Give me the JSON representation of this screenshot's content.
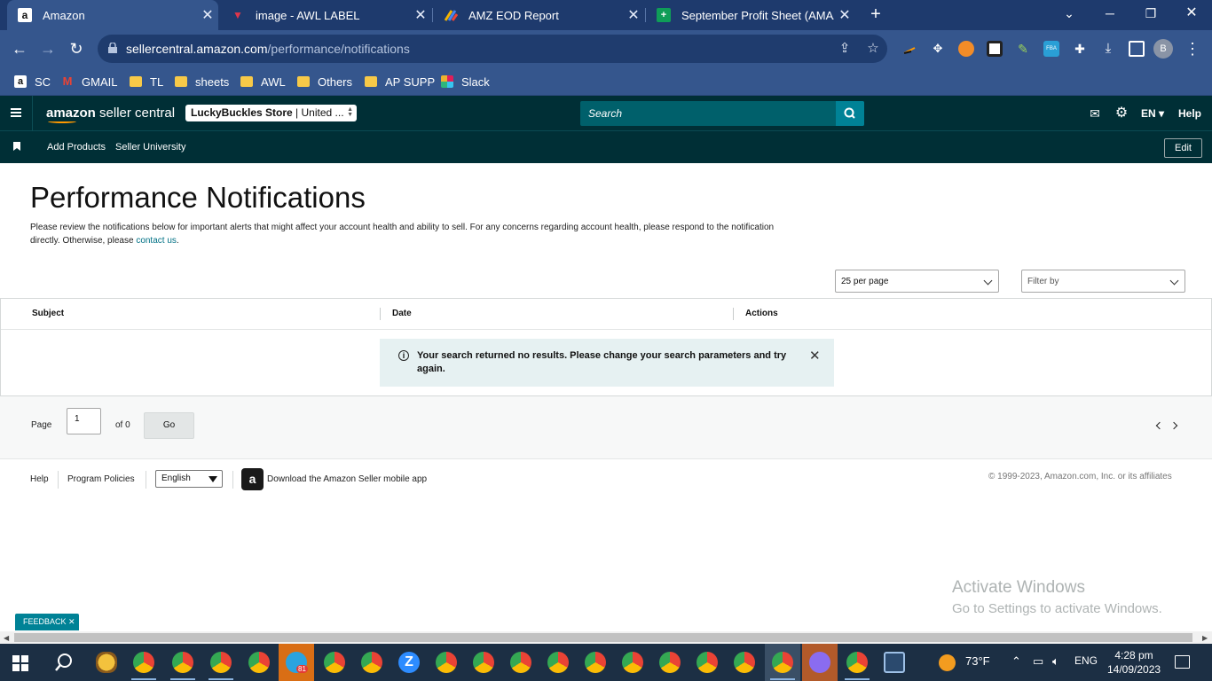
{
  "browser": {
    "tabs": [
      {
        "label": "Amazon",
        "active": true
      },
      {
        "label": "image - AWL LABEL",
        "active": false
      },
      {
        "label": "AMZ EOD Report",
        "active": false
      },
      {
        "label": "September Profit Sheet (AMAZIN",
        "active": false
      }
    ],
    "url_host": "sellercentral.amazon.com",
    "url_path": "/performance/notifications",
    "profile_initial": "B",
    "bookmarks": [
      "SC",
      "GMAIL",
      "TL",
      "sheets",
      "AWL",
      "Others",
      "AP SUPP",
      "Slack"
    ]
  },
  "header": {
    "logo_bold": "amazon",
    "logo_text": " seller central",
    "store_name": "LuckyBuckles Store",
    "store_region": " | United ...",
    "search_placeholder": "Search",
    "language": "EN",
    "help": "Help"
  },
  "subnav": {
    "links": [
      "Add Products",
      "Seller University"
    ],
    "edit": "Edit"
  },
  "main": {
    "title": "Performance Notifications",
    "description": "Please review the notifications below for important alerts that might affect your account health and ability to sell. For any concerns regarding account health, please respond to the notification directly. Otherwise, please ",
    "contact_link": "contact us",
    "per_page": "25 per page",
    "filter": "Filter by",
    "columns": [
      "Subject",
      "Date",
      "Actions"
    ],
    "alert": "Your search returned no results. Please change your search parameters and try again.",
    "pager": {
      "page_label": "Page",
      "page_value": "1",
      "of_label": "of 0",
      "go": "Go"
    }
  },
  "footer": {
    "help": "Help",
    "policies": "Program Policies",
    "language": "English",
    "download": "Download the Amazon Seller mobile app",
    "copyright": "© 1999-2023, Amazon.com, Inc. or its affiliates"
  },
  "overlay": {
    "activate_title": "Activate Windows",
    "activate_sub": "Go to Settings to activate Windows.",
    "feedback": "FEEDBACK ✕"
  },
  "taskbar": {
    "temperature": "73°F",
    "input_lang": "ENG",
    "time": "4:28 pm",
    "date": "14/09/2023",
    "telegram_badge": "81"
  },
  "colors": {
    "chrome_dark": "#1e3a6d",
    "chrome_toolbar": "#35568d",
    "sc_header": "#002f36",
    "search_bg": "#00606b",
    "accent_teal": "#008296",
    "link": "#007185"
  }
}
